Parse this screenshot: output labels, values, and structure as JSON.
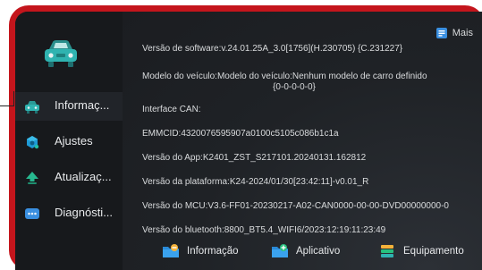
{
  "sidebar": {
    "items": [
      {
        "label": "Informaç...",
        "icon": "car-icon",
        "active": true
      },
      {
        "label": "Ajustes",
        "icon": "settings-icon",
        "active": false
      },
      {
        "label": "Atualizaç...",
        "icon": "update-icon",
        "active": false
      },
      {
        "label": "Diagnósti...",
        "icon": "diagnostic-icon",
        "active": false
      }
    ]
  },
  "header": {
    "more_label": "Mais"
  },
  "info": {
    "software": "Versão de software:v.24.01.25A_3.0[1756](H.230705) {C.231227}",
    "model_line1": "Modelo do veículo:Modelo do veículo:Nenhum modelo de carro definido",
    "model_line2": "{0-0-0-0-0}",
    "can": "Interface CAN:",
    "emmcid": "EMMCID:4320076595907a0100c5105c086b1c1a",
    "app": "Versão do App:K2401_ZST_S217101.20240131.162812",
    "platform": "Versão da plataforma:K24-2024/01/30[23:42:11]-v0.01_R",
    "mcu": "Versão do MCU:V3.6-FF01-20230217-A02-CAN0000-00-00-DVD00000000-0",
    "bluetooth": "Versão do bluetooth:8800_BT5.4_WIFI6/2023:12:19:11:23:49"
  },
  "tabs": [
    {
      "label": "Informação",
      "icon": "info-folder-icon"
    },
    {
      "label": "Aplicativo",
      "icon": "app-folder-icon"
    },
    {
      "label": "Equipamento",
      "icon": "equipment-icon"
    }
  ],
  "colors": {
    "frame": "#c4151c",
    "background": "#1c1f23",
    "sidebar": "#17191c",
    "accent_teal": "#22b5a3"
  }
}
